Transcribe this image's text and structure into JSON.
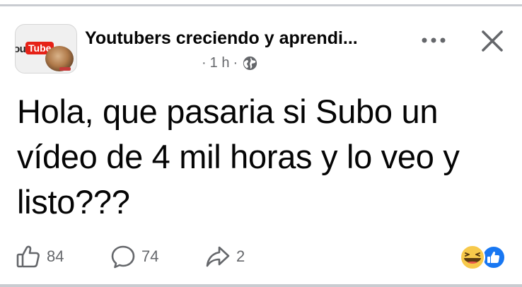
{
  "post": {
    "group_name": "Youtubers creciendo y aprendi...",
    "time": "1 h",
    "separator": "·",
    "text": "Hola, que pasaria si Subo un vídeo de 4 mil horas y lo veo y listo???",
    "avatar": {
      "logo_you": "ou",
      "logo_tube": "Tube"
    }
  },
  "icons": {
    "avatar": "group-avatar",
    "more": "more-horizontal-icon",
    "close": "close-icon",
    "privacy": "globe-icon",
    "like": "thumbs-up-icon",
    "comment": "comment-bubble-icon",
    "share": "share-arrow-icon",
    "reactions": [
      "haha-reaction-icon",
      "like-reaction-icon"
    ]
  },
  "stats": {
    "likes": "84",
    "comments": "74",
    "shares": "2"
  },
  "colors": {
    "text": "#050505",
    "secondary": "#65676b",
    "like_blue": "#1877f2",
    "haha_yellow": "#f7c94b",
    "youtube_red": "#e62117"
  }
}
